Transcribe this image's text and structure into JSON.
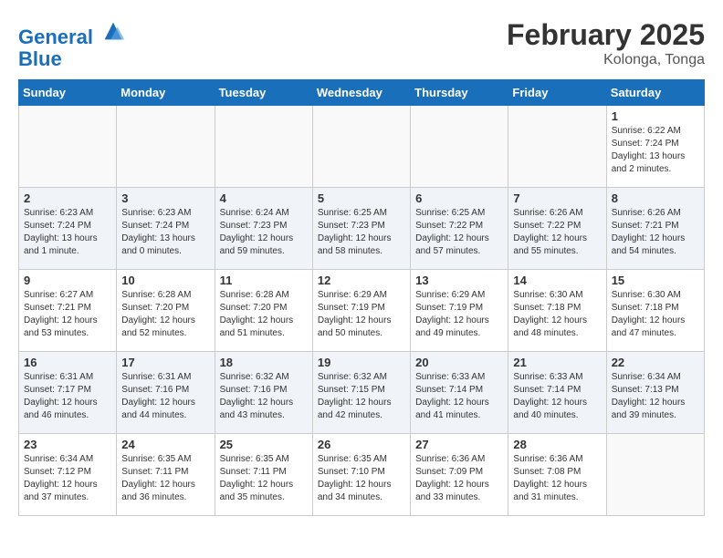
{
  "header": {
    "logo_line1": "General",
    "logo_line2": "Blue",
    "month": "February 2025",
    "location": "Kolonga, Tonga"
  },
  "weekdays": [
    "Sunday",
    "Monday",
    "Tuesday",
    "Wednesday",
    "Thursday",
    "Friday",
    "Saturday"
  ],
  "weeks": [
    [
      {
        "day": "",
        "info": ""
      },
      {
        "day": "",
        "info": ""
      },
      {
        "day": "",
        "info": ""
      },
      {
        "day": "",
        "info": ""
      },
      {
        "day": "",
        "info": ""
      },
      {
        "day": "",
        "info": ""
      },
      {
        "day": "1",
        "info": "Sunrise: 6:22 AM\nSunset: 7:24 PM\nDaylight: 13 hours\nand 2 minutes."
      }
    ],
    [
      {
        "day": "2",
        "info": "Sunrise: 6:23 AM\nSunset: 7:24 PM\nDaylight: 13 hours\nand 1 minute."
      },
      {
        "day": "3",
        "info": "Sunrise: 6:23 AM\nSunset: 7:24 PM\nDaylight: 13 hours\nand 0 minutes."
      },
      {
        "day": "4",
        "info": "Sunrise: 6:24 AM\nSunset: 7:23 PM\nDaylight: 12 hours\nand 59 minutes."
      },
      {
        "day": "5",
        "info": "Sunrise: 6:25 AM\nSunset: 7:23 PM\nDaylight: 12 hours\nand 58 minutes."
      },
      {
        "day": "6",
        "info": "Sunrise: 6:25 AM\nSunset: 7:22 PM\nDaylight: 12 hours\nand 57 minutes."
      },
      {
        "day": "7",
        "info": "Sunrise: 6:26 AM\nSunset: 7:22 PM\nDaylight: 12 hours\nand 55 minutes."
      },
      {
        "day": "8",
        "info": "Sunrise: 6:26 AM\nSunset: 7:21 PM\nDaylight: 12 hours\nand 54 minutes."
      }
    ],
    [
      {
        "day": "9",
        "info": "Sunrise: 6:27 AM\nSunset: 7:21 PM\nDaylight: 12 hours\nand 53 minutes."
      },
      {
        "day": "10",
        "info": "Sunrise: 6:28 AM\nSunset: 7:20 PM\nDaylight: 12 hours\nand 52 minutes."
      },
      {
        "day": "11",
        "info": "Sunrise: 6:28 AM\nSunset: 7:20 PM\nDaylight: 12 hours\nand 51 minutes."
      },
      {
        "day": "12",
        "info": "Sunrise: 6:29 AM\nSunset: 7:19 PM\nDaylight: 12 hours\nand 50 minutes."
      },
      {
        "day": "13",
        "info": "Sunrise: 6:29 AM\nSunset: 7:19 PM\nDaylight: 12 hours\nand 49 minutes."
      },
      {
        "day": "14",
        "info": "Sunrise: 6:30 AM\nSunset: 7:18 PM\nDaylight: 12 hours\nand 48 minutes."
      },
      {
        "day": "15",
        "info": "Sunrise: 6:30 AM\nSunset: 7:18 PM\nDaylight: 12 hours\nand 47 minutes."
      }
    ],
    [
      {
        "day": "16",
        "info": "Sunrise: 6:31 AM\nSunset: 7:17 PM\nDaylight: 12 hours\nand 46 minutes."
      },
      {
        "day": "17",
        "info": "Sunrise: 6:31 AM\nSunset: 7:16 PM\nDaylight: 12 hours\nand 44 minutes."
      },
      {
        "day": "18",
        "info": "Sunrise: 6:32 AM\nSunset: 7:16 PM\nDaylight: 12 hours\nand 43 minutes."
      },
      {
        "day": "19",
        "info": "Sunrise: 6:32 AM\nSunset: 7:15 PM\nDaylight: 12 hours\nand 42 minutes."
      },
      {
        "day": "20",
        "info": "Sunrise: 6:33 AM\nSunset: 7:14 PM\nDaylight: 12 hours\nand 41 minutes."
      },
      {
        "day": "21",
        "info": "Sunrise: 6:33 AM\nSunset: 7:14 PM\nDaylight: 12 hours\nand 40 minutes."
      },
      {
        "day": "22",
        "info": "Sunrise: 6:34 AM\nSunset: 7:13 PM\nDaylight: 12 hours\nand 39 minutes."
      }
    ],
    [
      {
        "day": "23",
        "info": "Sunrise: 6:34 AM\nSunset: 7:12 PM\nDaylight: 12 hours\nand 37 minutes."
      },
      {
        "day": "24",
        "info": "Sunrise: 6:35 AM\nSunset: 7:11 PM\nDaylight: 12 hours\nand 36 minutes."
      },
      {
        "day": "25",
        "info": "Sunrise: 6:35 AM\nSunset: 7:11 PM\nDaylight: 12 hours\nand 35 minutes."
      },
      {
        "day": "26",
        "info": "Sunrise: 6:35 AM\nSunset: 7:10 PM\nDaylight: 12 hours\nand 34 minutes."
      },
      {
        "day": "27",
        "info": "Sunrise: 6:36 AM\nSunset: 7:09 PM\nDaylight: 12 hours\nand 33 minutes."
      },
      {
        "day": "28",
        "info": "Sunrise: 6:36 AM\nSunset: 7:08 PM\nDaylight: 12 hours\nand 31 minutes."
      },
      {
        "day": "",
        "info": ""
      }
    ]
  ]
}
